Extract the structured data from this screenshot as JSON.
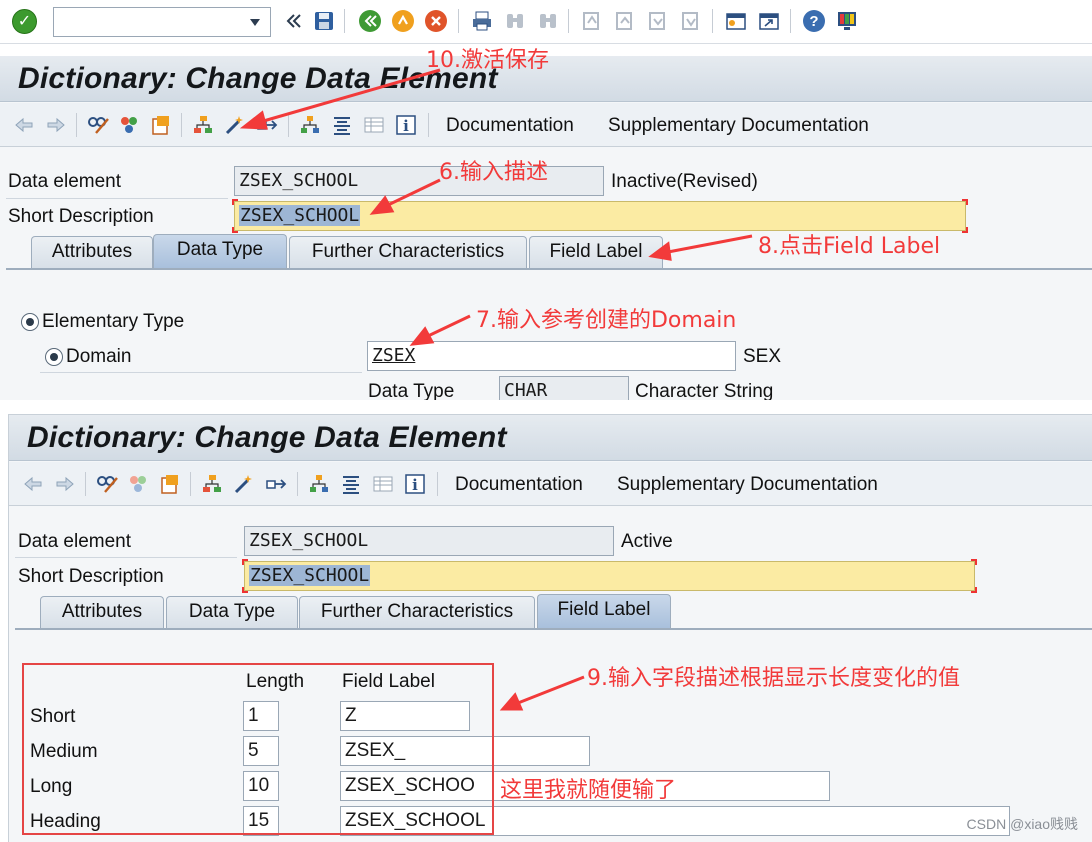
{
  "toolbar": {
    "command_field_value": "",
    "icons": [
      "enter-icon",
      "nav-back-icon",
      "save-icon",
      "back-icon",
      "exit-icon",
      "cancel-icon",
      "print-icon",
      "find-icon",
      "find-next-icon",
      "first-page-icon",
      "prev-page-icon",
      "next-page-icon",
      "last-page-icon",
      "new-session-icon",
      "shortcut-icon",
      "help-icon",
      "layout-icon"
    ]
  },
  "screen1": {
    "title": "Dictionary: Change Data Element",
    "app_toolbar": {
      "documentation": "Documentation",
      "supplementary_documentation": "Supplementary Documentation"
    },
    "data_element_label": "Data element",
    "data_element_value": "ZSEX_SCHOOL",
    "status": "Inactive(Revised)",
    "short_description_label": "Short Description",
    "short_description_value": "ZSEX_SCHOOL",
    "tabs": [
      "Attributes",
      "Data Type",
      "Further Characteristics",
      "Field Label"
    ],
    "active_tab": "Data Type",
    "elementary_type_label": "Elementary Type",
    "domain_label": "Domain",
    "domain_value": "ZSEX",
    "domain_desc": "SEX",
    "data_type_label": "Data Type",
    "data_type_value": "CHAR",
    "data_type_desc": "Character String"
  },
  "screen2": {
    "title": "Dictionary: Change Data Element",
    "app_toolbar": {
      "documentation": "Documentation",
      "supplementary_documentation": "Supplementary Documentation"
    },
    "data_element_label": "Data element",
    "data_element_value": "ZSEX_SCHOOL",
    "status": "Active",
    "short_description_label": "Short Description",
    "short_description_value": "ZSEX_SCHOOL",
    "tabs": [
      "Attributes",
      "Data Type",
      "Further Characteristics",
      "Field Label"
    ],
    "active_tab": "Field Label",
    "field_labels": {
      "header_length": "Length",
      "header_field_label": "Field Label",
      "rows": [
        {
          "name": "Short",
          "length": "1",
          "label": "Z"
        },
        {
          "name": "Medium",
          "length": "5",
          "label": "ZSEX_"
        },
        {
          "name": "Long",
          "length": "10",
          "label": "ZSEX_SCHOO"
        },
        {
          "name": "Heading",
          "length": "15",
          "label": "ZSEX_SCHOOL"
        }
      ]
    }
  },
  "annotations": {
    "a10": "10.激活保存",
    "a6": "6.输入描述",
    "a8": "8.点击Field Label",
    "a7": "7.输入参考创建的Domain",
    "a9": "9.输入字段描述根据显示长度变化的值",
    "note": "这里我就随便输了"
  },
  "watermark": "CSDN @xiao贱贱",
  "colors": {
    "annotation": "#f23a3a",
    "required_field": "#fbeba3",
    "active_tab": "#a9c0dc",
    "selection": "#9db6d5"
  }
}
